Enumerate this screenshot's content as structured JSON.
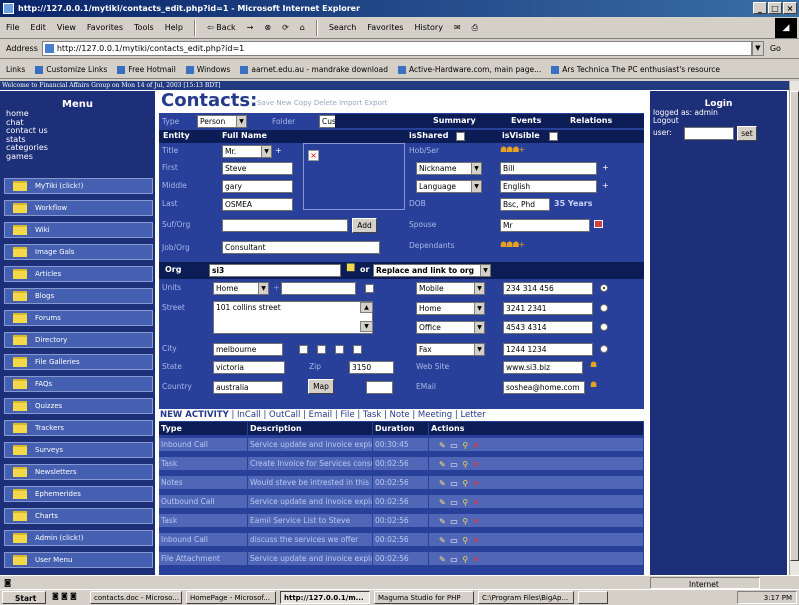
{
  "window": {
    "title": "http://127.0.0.1/mytiki/contacts_edit.php?id=1 - Microsoft Internet Explorer"
  },
  "menubar": {
    "items": [
      "File",
      "Edit",
      "View",
      "Favorites",
      "Tools",
      "Help"
    ],
    "back": "⇦ Back",
    "search": "Search",
    "favorites": "Favorites",
    "history": "History"
  },
  "address": {
    "label": "Address",
    "url": "http://127.0.0.1/mytiki/contacts_edit.php?id=1",
    "go": "Go"
  },
  "links": {
    "label": "Links",
    "items": [
      "Customize Links",
      "Free Hotmail",
      "Windows",
      "aarnet.edu.au - mandrake download",
      "Active-Hardware.com, main page...",
      "Ars Technica The PC enthusiast's resource"
    ]
  },
  "welcome": "Welcome to Financial Affairs Group on Mon 14 of Jul, 2003 [15:13 BDT]",
  "leftmenu": {
    "title": "Menu",
    "text_links": [
      "home",
      "chat",
      "contact us",
      "stats",
      "categories",
      "games"
    ],
    "items": [
      "MyTiki (click!)",
      "Workflow",
      "Wiki",
      "Image Gals",
      "Articles",
      "Blogs",
      "Forums",
      "Directory",
      "File Galleries",
      "FAQs",
      "Quizzes",
      "Trackers",
      "Surveys",
      "Newsletters",
      "Ephemerides",
      "Charts",
      "Admin (click!)",
      "User Menu"
    ]
  },
  "contacts": {
    "title": "Contacts:",
    "actions": "Save New Copy Delete Import Export",
    "type_label": "Type",
    "type_value": "Person",
    "folder_label": "Folder",
    "folder_value": "Customers",
    "tabs": [
      "Summary",
      "Events",
      "Relations"
    ],
    "entity": "Entity",
    "full_name": "Full Name",
    "isShared": "isShared",
    "isVisible": "isVisible",
    "title_label": "Title",
    "title_value": "Mr.",
    "first_label": "First",
    "first_value": "Steve",
    "middle_label": "Middle",
    "middle_value": "gary",
    "last_label": "Last",
    "last_value": "OSMEA",
    "suforg_label": "Suf/Org",
    "add_button": "Add",
    "joborg_label": "Job/Org",
    "joborg_value": "Consultant",
    "hobser_label": "Hob/Ser",
    "nickname_select": "Nickname",
    "nickname_value": "Bill",
    "language_select": "Language",
    "language_value": "English",
    "dob_label": "DOB",
    "dob_value": "Bsc, Phd",
    "years": "35 Years",
    "spouse_label": "Spouse",
    "spouse_value": "Mr",
    "dependants_label": "Dependants",
    "org_label": "Org",
    "org_value": "si3",
    "or_text": "or",
    "org_action": "Replace and link to org",
    "units_label": "Units",
    "units_value": "Home",
    "street_label": "Street",
    "street_value": "101 collins street",
    "city_label": "City",
    "city_value": "melbourne",
    "state_label": "State",
    "state_value": "victoria",
    "zip_label": "Zip",
    "zip_value": "3150",
    "country_label": "Country",
    "country_value": "australia",
    "map_button": "Map",
    "phones": [
      {
        "type": "Mobile",
        "number": "234 314 456"
      },
      {
        "type": "Home",
        "number": "3241 2341"
      },
      {
        "type": "Office",
        "number": "4543 4314"
      },
      {
        "type": "Fax",
        "number": "1244 1234"
      }
    ],
    "website_label": "Web Site",
    "website_value": "www.si3.biz",
    "email_label": "EMail",
    "email_value": "soshea@home.com"
  },
  "activity": {
    "title": "NEW ACTIVITY",
    "links": "| InCall | OutCall | Email | File | Task | Note | Meeting | Letter",
    "headers": [
      "Type",
      "Description",
      "Duration",
      "Actions"
    ],
    "rows": [
      [
        "Inbound Call",
        "Service update and invoice explanation",
        "00:30:45"
      ],
      [
        "Task",
        "Create Invoice for Services consumed",
        "00:02:56"
      ],
      [
        "Notes",
        "Would steve be intrested in this service?",
        "00:02:56"
      ],
      [
        "Outbound Call",
        "Service update and invoice explanation",
        "00:02:56"
      ],
      [
        "Task",
        "Eamil Service List to Steve",
        "00:02:56"
      ],
      [
        "Inbound Call",
        "discuss the services we offer",
        "00:02:56"
      ],
      [
        "File Attachment",
        "Service update and invoice explanation",
        "00:02:56"
      ]
    ]
  },
  "login": {
    "title": "Login",
    "logged_as": "logged as: admin",
    "logout": "Logout",
    "user_label": "user:",
    "set_button": "set"
  },
  "status": {
    "zone": "Internet"
  },
  "taskbar": {
    "start": "Start",
    "items": [
      "contacts.doc - Microso...",
      "HomePage - Microsof...",
      "http://127.0.0.1/m...",
      "Maguma Studio for PHP",
      "C:\\Program Files\\BigAp...",
      ""
    ],
    "clock": "3:17 PM"
  }
}
